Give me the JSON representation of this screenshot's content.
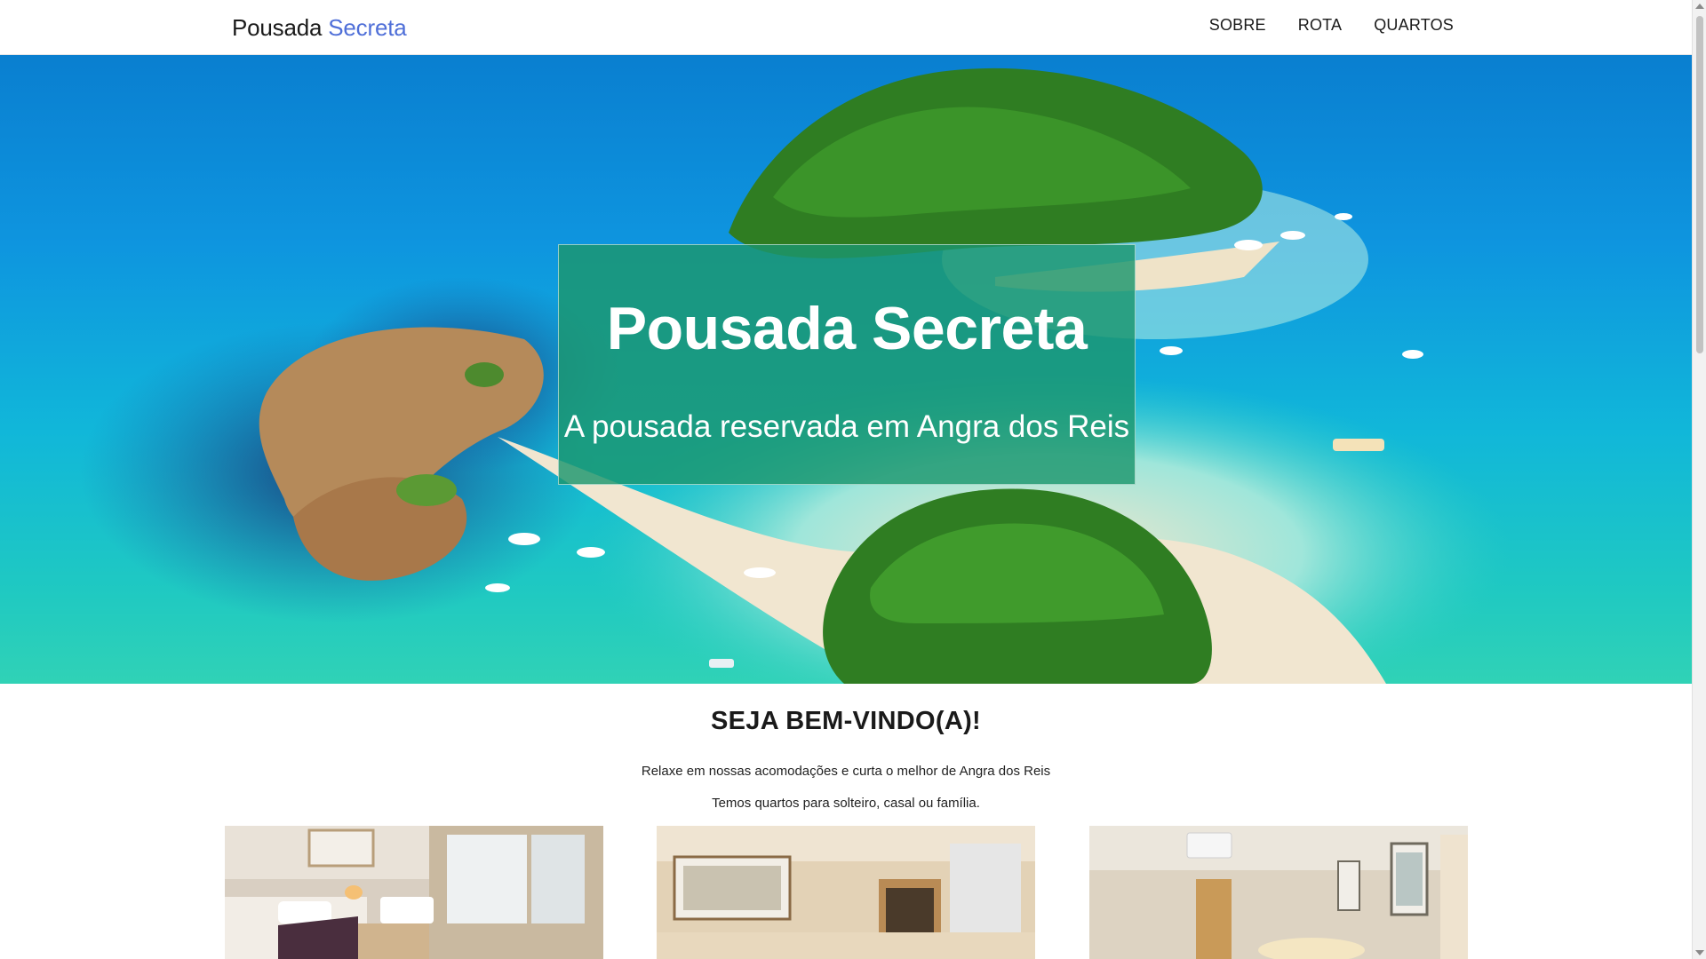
{
  "navbar": {
    "brand_part1": "Pousada",
    "brand_part2": "Secreta",
    "links": [
      "SOBRE",
      "ROTA",
      "QUARTOS"
    ]
  },
  "hero": {
    "title": "Pousada Secreta",
    "subtitle": "A pousada reservada em Angra dos Reis",
    "image_icon": "beach-island-photo"
  },
  "welcome": {
    "title": "SEJA BEM-VINDO(A)!",
    "line1": "Relaxe em nossas acomodações e curta o melhor de Angra dos Reis",
    "line2": "Temos quartos para solteiro, casal ou família."
  },
  "rooms": [
    {
      "icon": "room-photo-solteiro"
    },
    {
      "icon": "room-photo-casal"
    },
    {
      "icon": "room-photo-familia"
    }
  ],
  "colors": {
    "brand_accent": "#4f6fd8",
    "hero_box": "#1c966e",
    "text": "#1a1a1a"
  }
}
